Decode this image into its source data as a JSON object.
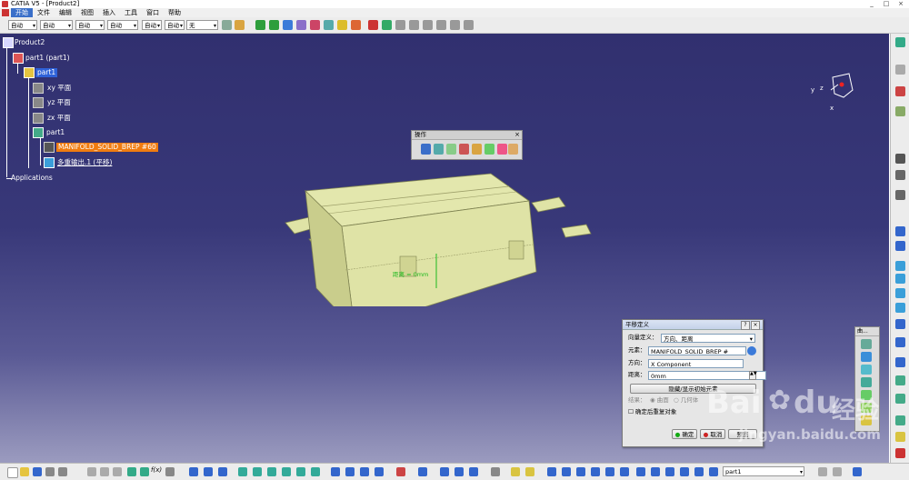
{
  "window": {
    "title": "CATIA V5 - [Product2]",
    "controls": [
      "_",
      "□",
      "×"
    ]
  },
  "menu": {
    "items": [
      "开始",
      "文件",
      "编辑",
      "视图",
      "插入",
      "工具",
      "窗口",
      "帮助"
    ]
  },
  "toolbar": {
    "combos": [
      "自动",
      "自动",
      "自动",
      "自动",
      "自动",
      "自动",
      "无"
    ]
  },
  "tree": {
    "root": "Product2",
    "part_instance": "part1 (part1)",
    "part_node": "part1",
    "planes": [
      "xy 平面",
      "yz 平面",
      "zx 平面"
    ],
    "body": "part1",
    "manifold": "MANIFOLD_SOLID_BREP #60",
    "multi_output": "多重输出.1 (平移)",
    "applications": "Applications"
  },
  "model": {
    "measure_label": "距离 = 0mm",
    "colors": {
      "body": "#dfe3a6",
      "body_shadow": "#b8bc7a",
      "edge": "#7f8352"
    }
  },
  "compass": {
    "axes": [
      "x",
      "y",
      "z"
    ]
  },
  "ops_toolbar": {
    "title": "操作"
  },
  "side_toolbar": {
    "title": "曲..."
  },
  "dialog": {
    "title": "平移定义",
    "vector_label": "向量定义：",
    "vector_value": "方向、距离",
    "element_label": "元素：",
    "element_value": "MANIFOLD_SOLID_BREP #",
    "direction_label": "方向：",
    "direction_value": "X Component",
    "distance_label": "距离：",
    "distance_value": "0mm",
    "hide_show_button": "隐藏/显示初始元素",
    "result_label": "结果：",
    "result_opt1": "曲面",
    "result_opt2": "几何体",
    "confirm_check": "确定后重复对象",
    "ok": "确定",
    "cancel": "取消",
    "preview": "预览"
  },
  "bottom": {
    "part_combo": "part1",
    "fx": "f(x)"
  },
  "watermark": {
    "brand": "Bai",
    "brand2": "du",
    "cn": "经验",
    "url": "jingyan.baidu.com"
  }
}
